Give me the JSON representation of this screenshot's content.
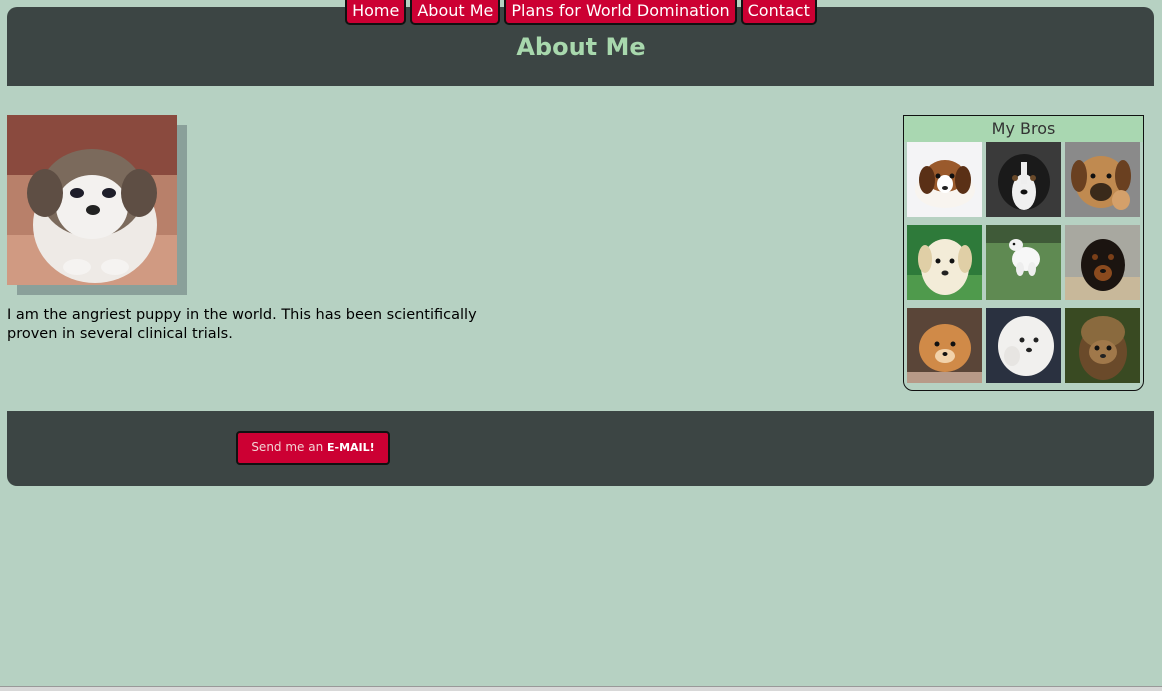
{
  "nav": {
    "items": [
      {
        "label": "Home"
      },
      {
        "label": "About Me"
      },
      {
        "label": "Plans for World Domination"
      },
      {
        "label": "Contact"
      }
    ]
  },
  "header": {
    "title": "About Me"
  },
  "main": {
    "bio": "I am the angriest puppy in the world. This has been scientifically proven in several clinical trials."
  },
  "sidebar": {
    "title": "My Bros",
    "images": [
      {
        "icon": "beagle-puppy-photo"
      },
      {
        "icon": "black-white-puppy-photo"
      },
      {
        "icon": "tan-puppy-waving-photo"
      },
      {
        "icon": "lab-puppy-photo"
      },
      {
        "icon": "white-puppy-running-photo"
      },
      {
        "icon": "rottweiler-puppy-photo"
      },
      {
        "icon": "fluffy-orange-puppy-photo"
      },
      {
        "icon": "white-fluffy-puppy-photo"
      },
      {
        "icon": "ewok-photo"
      }
    ]
  },
  "footer": {
    "email_prefix": "Send me an ",
    "email_strong": "E-MAIL!"
  },
  "colors": {
    "background": "#b6d1c2",
    "panel": "#3c4544",
    "accent": "#cc0033",
    "title": "#a8d8ad"
  }
}
